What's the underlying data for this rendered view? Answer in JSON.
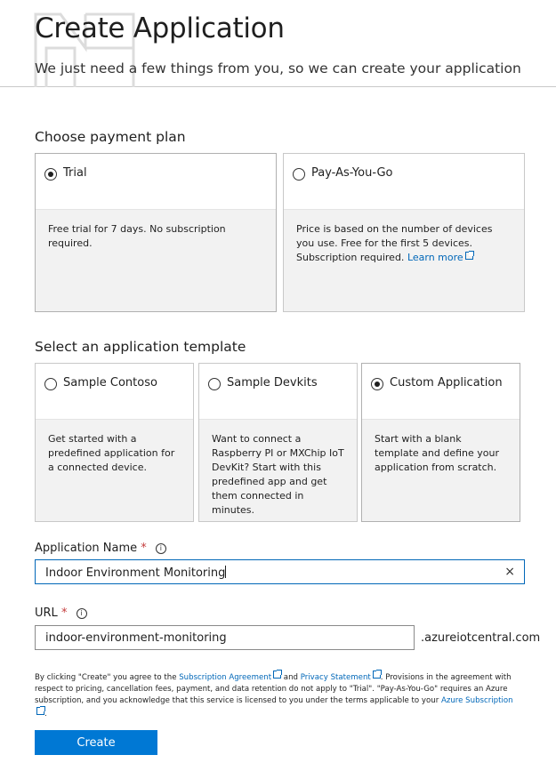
{
  "header": {
    "title": "Create Application",
    "subtitle": "We just need a few things from you, so we can create your application"
  },
  "payment": {
    "section_title": "Choose payment plan",
    "plans": [
      {
        "label": "Trial",
        "selected": true,
        "description": "Free trial for 7 days. No subscription required."
      },
      {
        "label": "Pay-As-You-Go",
        "selected": false,
        "description": "Price is based on the number of devices you use. Free for the first 5 devices. Subscription required.",
        "link_text": "Learn more"
      }
    ]
  },
  "template": {
    "section_title": "Select an application template",
    "options": [
      {
        "label": "Sample Contoso",
        "selected": false,
        "description": "Get started with a predefined application for a connected device."
      },
      {
        "label": "Sample Devkits",
        "selected": false,
        "description": "Want to connect a Raspberry PI or MXChip IoT DevKit? Start with this predefined app and get them connected in minutes."
      },
      {
        "label": "Custom Application",
        "selected": true,
        "description": "Start with a blank template and define your application from scratch."
      }
    ]
  },
  "form": {
    "app_name_label": "Application Name",
    "app_name_value": "Indoor Environment Monitoring",
    "url_label": "URL",
    "url_value": "indoor-environment-monitoring",
    "url_suffix": ".azureiotcentral.com",
    "required_marker": "*",
    "info_glyph": "i",
    "clear_glyph": "×"
  },
  "legal": {
    "part1": "By clicking \"Create\" you agree to the ",
    "subscription_agreement": "Subscription Agreement",
    "part2": " and ",
    "privacy_statement": "Privacy Statement",
    "part3": ". Provisions in the agreement with respect to pricing, cancellation fees, payment, and data retention do not apply to \"Trial\". \"Pay-As-You-Go\" requires an Azure subscription, and you acknowledge that this service is licensed to you under the terms applicable to your ",
    "azure_subscription": "Azure Subscription",
    "part4": "."
  },
  "actions": {
    "create_label": "Create"
  },
  "colors": {
    "accent": "#0078d4",
    "link": "#0067b8",
    "required": "#c43c3c"
  }
}
